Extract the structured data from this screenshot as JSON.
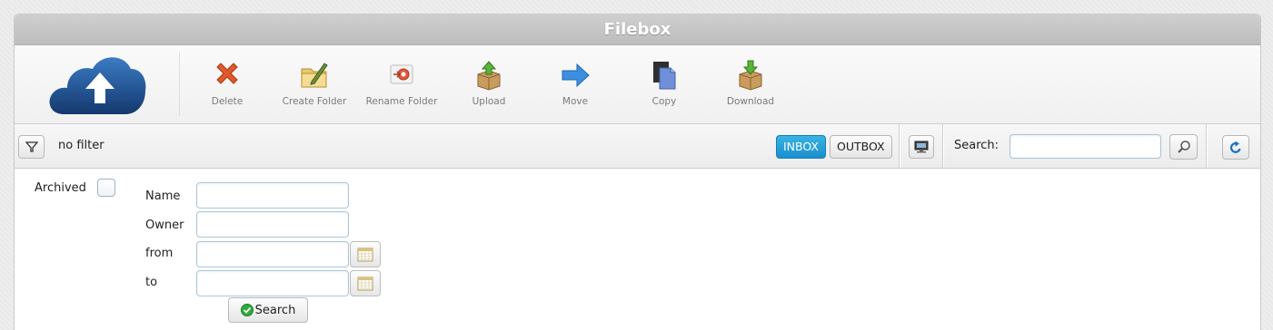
{
  "app": {
    "title": "Filebox"
  },
  "toolbar": {
    "tools": [
      {
        "label": "Delete",
        "icon": "delete-icon"
      },
      {
        "label": "Create Folder",
        "icon": "create-folder-icon"
      },
      {
        "label": "Rename Folder",
        "icon": "rename-folder-icon"
      },
      {
        "label": "Upload",
        "icon": "upload-icon"
      },
      {
        "label": "Move",
        "icon": "move-arrow-icon"
      },
      {
        "label": "Copy",
        "icon": "copy-icon"
      },
      {
        "label": "Download",
        "icon": "download-icon"
      }
    ]
  },
  "filterbar": {
    "filter_text": "no filter",
    "inbox_label": "INBOX",
    "outbox_label": "OUTBOX",
    "active_box": "INBOX",
    "search_label": "Search:",
    "search_value": ""
  },
  "form": {
    "archived_label": "Archived",
    "archived_checked": false,
    "name_label": "Name",
    "name_value": "",
    "owner_label": "Owner",
    "owner_value": "",
    "from_label": "from",
    "from_value": "",
    "to_label": "to",
    "to_value": "",
    "search_button": "Search"
  },
  "colors": {
    "accent": "#1a8fcd",
    "logo_blue": "#1e4f8e",
    "titlebar": "#c4c4c4"
  }
}
